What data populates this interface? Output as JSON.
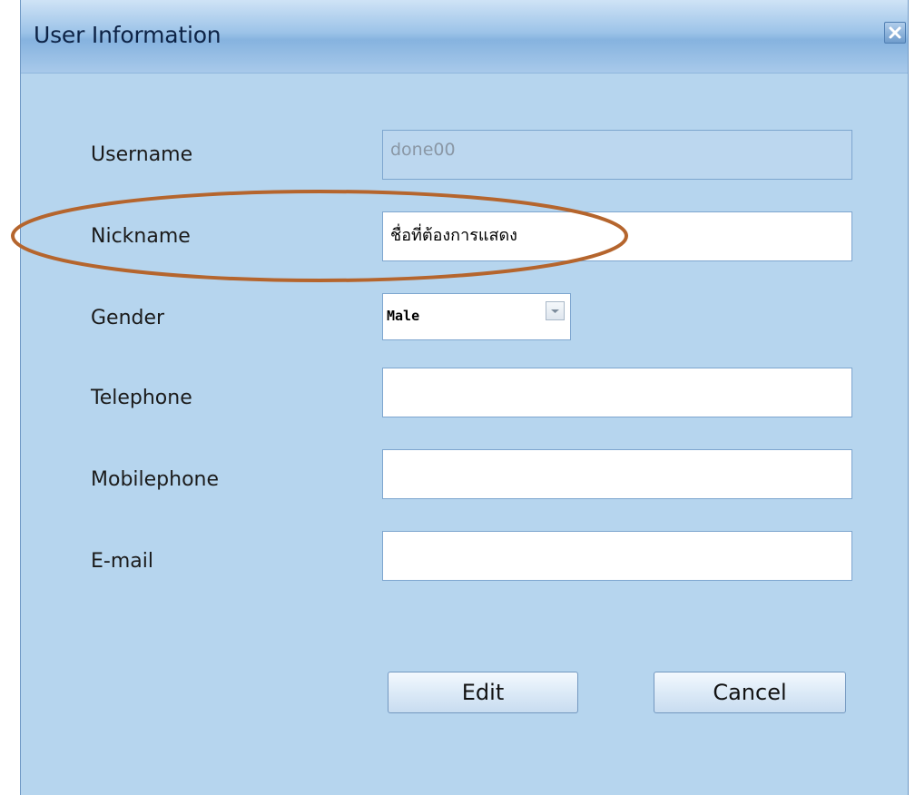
{
  "window": {
    "title": "User Information"
  },
  "form": {
    "username": {
      "label": "Username",
      "value": "done00"
    },
    "nickname": {
      "label": "Nickname",
      "value": "ชื่อที่ต้องการแสดง"
    },
    "gender": {
      "label": "Gender",
      "value": "Male"
    },
    "telephone": {
      "label": "Telephone",
      "value": ""
    },
    "mobilephone": {
      "label": "Mobilephone",
      "value": ""
    },
    "email": {
      "label": "E-mail",
      "value": ""
    }
  },
  "buttons": {
    "edit_label": "Edit",
    "cancel_label": "Cancel"
  },
  "colors": {
    "highlight_ellipse": "#b5652d",
    "window_background": "#b6d5ee"
  },
  "icons": {
    "close": "close-icon",
    "dropdown": "chevron-down-icon"
  }
}
